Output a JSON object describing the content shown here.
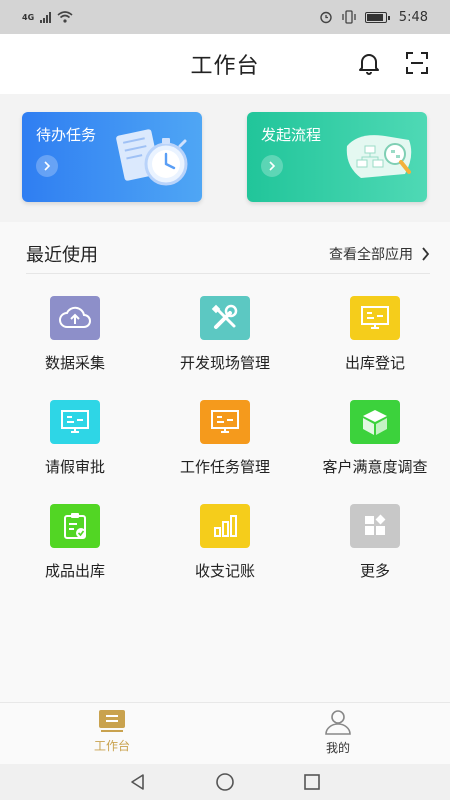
{
  "status_bar": {
    "network": "4G",
    "time": "5:48"
  },
  "header": {
    "title": "工作台"
  },
  "cards": {
    "todo": {
      "label": "待办任务",
      "color": "#3a8cf3"
    },
    "flow": {
      "label": "发起流程",
      "color": "#2ccda5"
    }
  },
  "recent": {
    "title": "最近使用",
    "view_all": "查看全部应用",
    "apps": [
      {
        "label": "数据采集",
        "icon": "cloud-upload-icon",
        "color": "#8d8fc9"
      },
      {
        "label": "开发现场管理",
        "icon": "tools-icon",
        "color": "#5cc8c2"
      },
      {
        "label": "出库登记",
        "icon": "monitor-icon",
        "color": "#f5cd1b"
      },
      {
        "label": "请假审批",
        "icon": "monitor-icon",
        "color": "#2ed6e6"
      },
      {
        "label": "工作任务管理",
        "icon": "monitor-icon",
        "color": "#f59a1c"
      },
      {
        "label": "客户满意度调查",
        "icon": "cube-icon",
        "color": "#3cd23c"
      },
      {
        "label": "成品出库",
        "icon": "clipboard-icon",
        "color": "#52d624"
      },
      {
        "label": "收支记账",
        "icon": "bar-chart-icon",
        "color": "#f5cd1b"
      },
      {
        "label": "更多",
        "icon": "more-grid-icon",
        "color": "#c8c8c8"
      }
    ]
  },
  "tabs": [
    {
      "label": "工作台",
      "icon": "workbench-icon",
      "active": true,
      "color": "#c9a24e"
    },
    {
      "label": "我的",
      "icon": "user-icon",
      "active": false
    }
  ]
}
